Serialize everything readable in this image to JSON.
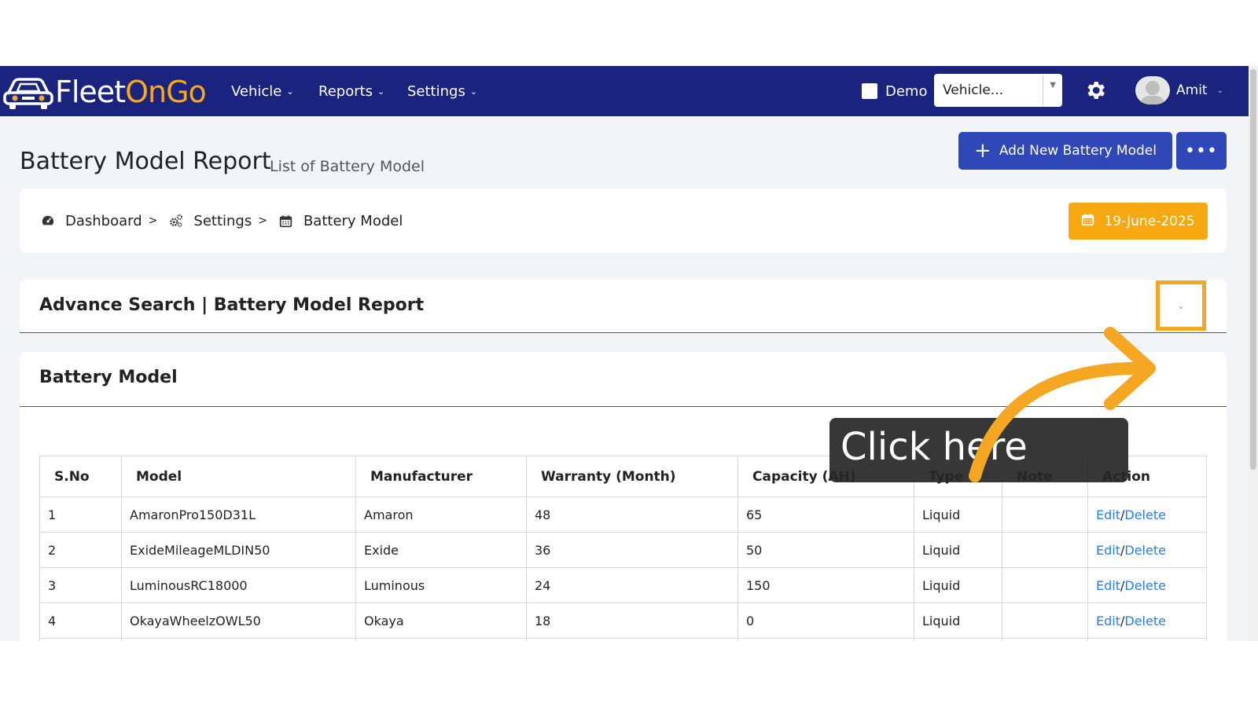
{
  "navbar": {
    "logo_text_white": "Fleet",
    "logo_text_yellow": "OnGo",
    "menus": [
      {
        "label": "Vehicle"
      },
      {
        "label": "Reports"
      },
      {
        "label": "Settings"
      }
    ],
    "demo_label": "Demo",
    "vehicle_select_value": "Vehicle...",
    "user_name": "Amit"
  },
  "page": {
    "title": "Battery Model Report",
    "subtitle": "List of Battery Model",
    "add_button_label": "Add New Battery Model",
    "more_button_label": "•••"
  },
  "breadcrumb": {
    "items": [
      {
        "label": "Dashboard",
        "icon": "tachometer-icon"
      },
      {
        "label": "Settings",
        "icon": "cogs-icon"
      },
      {
        "label": "Battery Model",
        "icon": "calendar-icon"
      }
    ],
    "date": "19-June-2025"
  },
  "advance_search": {
    "title": "Advance Search | Battery Model Report"
  },
  "battery": {
    "title": "Battery Model",
    "columns": [
      "S.No",
      "Model",
      "Manufacturer",
      "Warranty (Month)",
      "Capacity (AH)",
      "Type",
      "Note",
      "Action"
    ],
    "rows": [
      {
        "sno": "1",
        "model": "AmaronPro150D31L",
        "manufacturer": "Amaron",
        "warranty": "48",
        "capacity": "65",
        "type": "Liquid",
        "note": "",
        "edit": "Edit",
        "delete": "Delete"
      },
      {
        "sno": "2",
        "model": "ExideMileageMLDIN50",
        "manufacturer": "Exide",
        "warranty": "36",
        "capacity": "50",
        "type": "Liquid",
        "note": "",
        "edit": "Edit",
        "delete": "Delete"
      },
      {
        "sno": "3",
        "model": "LuminousRC18000",
        "manufacturer": "Luminous",
        "warranty": "24",
        "capacity": "150",
        "type": "Liquid",
        "note": "",
        "edit": "Edit",
        "delete": "Delete"
      },
      {
        "sno": "4",
        "model": "OkayaWheelzOWL50",
        "manufacturer": "Okaya",
        "warranty": "18",
        "capacity": "0",
        "type": "Liquid",
        "note": "",
        "edit": "Edit",
        "delete": "Delete"
      }
    ],
    "action_separator": "/"
  },
  "overlay": {
    "callout_text": "Click here",
    "highlight_color": "#f5a623"
  },
  "colors": {
    "navbar": "#1a237e",
    "primary_button": "#3047b8",
    "date_button": "#f5a80f",
    "link": "#2a7de1"
  }
}
